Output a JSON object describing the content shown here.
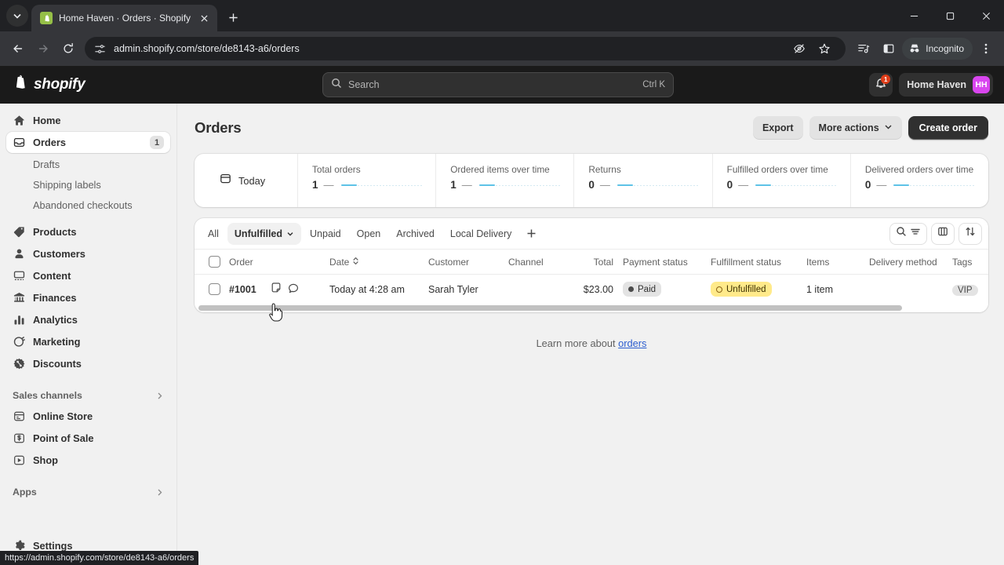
{
  "browser": {
    "tab": {
      "title": "Home Haven · Orders · Shopify",
      "favicon": "shopify-icon",
      "close": "close-icon"
    },
    "new_tab_label": "+",
    "omnibox": {
      "url": "admin.shopify.com/store/de8143-a6/orders",
      "site_settings_icon": "site-settings-icon"
    },
    "incognito_label": "Incognito",
    "window_controls": [
      "minimize",
      "maximize",
      "close"
    ],
    "status_bar_url": "https://admin.shopify.com/store/de8143-a6/orders"
  },
  "topbar": {
    "wordmark": "shopify",
    "search": {
      "placeholder": "Search",
      "shortcut": "Ctrl K"
    },
    "notifications": {
      "count": "1"
    },
    "store": {
      "name": "Home Haven",
      "initials": "HH",
      "avatar_color": "#d946ef"
    }
  },
  "sidebar": {
    "items": [
      {
        "label": "Home",
        "icon": "home-icon",
        "badge": "",
        "active": false
      },
      {
        "label": "Orders",
        "icon": "orders-icon",
        "badge": "1",
        "active": true
      }
    ],
    "orders_sub": [
      {
        "label": "Drafts"
      },
      {
        "label": "Shipping labels"
      },
      {
        "label": "Abandoned checkouts"
      }
    ],
    "items2": [
      {
        "label": "Products",
        "icon": "products-icon"
      },
      {
        "label": "Customers",
        "icon": "customers-icon"
      },
      {
        "label": "Content",
        "icon": "content-icon"
      },
      {
        "label": "Finances",
        "icon": "finances-icon"
      },
      {
        "label": "Analytics",
        "icon": "analytics-icon"
      },
      {
        "label": "Marketing",
        "icon": "marketing-icon"
      },
      {
        "label": "Discounts",
        "icon": "discounts-icon"
      }
    ],
    "sales_channels": {
      "title": "Sales channels",
      "items": [
        {
          "label": "Online Store",
          "icon": "online-store-icon"
        },
        {
          "label": "Point of Sale",
          "icon": "point-of-sale-icon"
        },
        {
          "label": "Shop",
          "icon": "shop-icon"
        }
      ]
    },
    "apps": {
      "title": "Apps"
    },
    "settings": {
      "label": "Settings",
      "icon": "gear-icon"
    }
  },
  "page": {
    "title": "Orders",
    "actions": {
      "export": "Export",
      "more_actions": "More actions",
      "create_order": "Create order"
    }
  },
  "metrics": {
    "period_label": "Today",
    "cards": [
      {
        "label": "Total orders",
        "value": "1",
        "delta": "—"
      },
      {
        "label": "Ordered items over time",
        "value": "1",
        "delta": "—"
      },
      {
        "label": "Returns",
        "value": "0",
        "delta": "—"
      },
      {
        "label": "Fulfilled orders over time",
        "value": "0",
        "delta": "—"
      },
      {
        "label": "Delivered orders over time",
        "value": "0",
        "delta": "—"
      }
    ]
  },
  "filter_tabs": {
    "tabs": [
      {
        "label": "All",
        "selected": false,
        "has_chevron": false
      },
      {
        "label": "Unfulfilled",
        "selected": true,
        "has_chevron": true
      },
      {
        "label": "Unpaid",
        "selected": false,
        "has_chevron": false
      },
      {
        "label": "Open",
        "selected": false,
        "has_chevron": false
      },
      {
        "label": "Archived",
        "selected": false,
        "has_chevron": false
      },
      {
        "label": "Local Delivery",
        "selected": false,
        "has_chevron": false
      }
    ],
    "add_label": "+",
    "tools": [
      "search-filter-icon",
      "columns-icon",
      "sort-icon"
    ]
  },
  "table": {
    "columns": [
      "Order",
      "Date",
      "Customer",
      "Channel",
      "Total",
      "Payment status",
      "Fulfillment status",
      "Items",
      "Delivery method",
      "Tags"
    ],
    "rows": [
      {
        "order": "#1001",
        "date": "Today at 4:28 am",
        "customer": "Sarah Tyler",
        "channel": "",
        "total": "$23.00",
        "payment_status": "Paid",
        "fulfillment_status": "Unfulfilled",
        "items": "1 item",
        "delivery_method": "",
        "tags": "VIP"
      }
    ]
  },
  "footer": {
    "learn_more_prefix": "Learn more about ",
    "learn_more_link": "orders"
  }
}
